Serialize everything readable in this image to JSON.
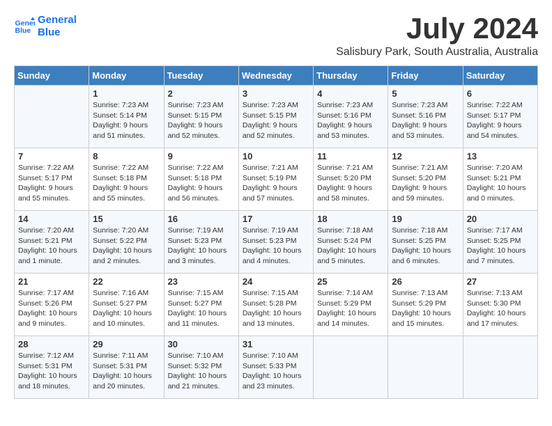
{
  "logo": {
    "line1": "General",
    "line2": "Blue"
  },
  "title": "July 2024",
  "subtitle": "Salisbury Park, South Australia, Australia",
  "days_header": [
    "Sunday",
    "Monday",
    "Tuesday",
    "Wednesday",
    "Thursday",
    "Friday",
    "Saturday"
  ],
  "weeks": [
    [
      {
        "num": "",
        "detail": ""
      },
      {
        "num": "1",
        "detail": "Sunrise: 7:23 AM\nSunset: 5:14 PM\nDaylight: 9 hours\nand 51 minutes."
      },
      {
        "num": "2",
        "detail": "Sunrise: 7:23 AM\nSunset: 5:15 PM\nDaylight: 9 hours\nand 52 minutes."
      },
      {
        "num": "3",
        "detail": "Sunrise: 7:23 AM\nSunset: 5:15 PM\nDaylight: 9 hours\nand 52 minutes."
      },
      {
        "num": "4",
        "detail": "Sunrise: 7:23 AM\nSunset: 5:16 PM\nDaylight: 9 hours\nand 53 minutes."
      },
      {
        "num": "5",
        "detail": "Sunrise: 7:23 AM\nSunset: 5:16 PM\nDaylight: 9 hours\nand 53 minutes."
      },
      {
        "num": "6",
        "detail": "Sunrise: 7:22 AM\nSunset: 5:17 PM\nDaylight: 9 hours\nand 54 minutes."
      }
    ],
    [
      {
        "num": "7",
        "detail": "Sunrise: 7:22 AM\nSunset: 5:17 PM\nDaylight: 9 hours\nand 55 minutes."
      },
      {
        "num": "8",
        "detail": "Sunrise: 7:22 AM\nSunset: 5:18 PM\nDaylight: 9 hours\nand 55 minutes."
      },
      {
        "num": "9",
        "detail": "Sunrise: 7:22 AM\nSunset: 5:18 PM\nDaylight: 9 hours\nand 56 minutes."
      },
      {
        "num": "10",
        "detail": "Sunrise: 7:21 AM\nSunset: 5:19 PM\nDaylight: 9 hours\nand 57 minutes."
      },
      {
        "num": "11",
        "detail": "Sunrise: 7:21 AM\nSunset: 5:20 PM\nDaylight: 9 hours\nand 58 minutes."
      },
      {
        "num": "12",
        "detail": "Sunrise: 7:21 AM\nSunset: 5:20 PM\nDaylight: 9 hours\nand 59 minutes."
      },
      {
        "num": "13",
        "detail": "Sunrise: 7:20 AM\nSunset: 5:21 PM\nDaylight: 10 hours\nand 0 minutes."
      }
    ],
    [
      {
        "num": "14",
        "detail": "Sunrise: 7:20 AM\nSunset: 5:21 PM\nDaylight: 10 hours\nand 1 minute."
      },
      {
        "num": "15",
        "detail": "Sunrise: 7:20 AM\nSunset: 5:22 PM\nDaylight: 10 hours\nand 2 minutes."
      },
      {
        "num": "16",
        "detail": "Sunrise: 7:19 AM\nSunset: 5:23 PM\nDaylight: 10 hours\nand 3 minutes."
      },
      {
        "num": "17",
        "detail": "Sunrise: 7:19 AM\nSunset: 5:23 PM\nDaylight: 10 hours\nand 4 minutes."
      },
      {
        "num": "18",
        "detail": "Sunrise: 7:18 AM\nSunset: 5:24 PM\nDaylight: 10 hours\nand 5 minutes."
      },
      {
        "num": "19",
        "detail": "Sunrise: 7:18 AM\nSunset: 5:25 PM\nDaylight: 10 hours\nand 6 minutes."
      },
      {
        "num": "20",
        "detail": "Sunrise: 7:17 AM\nSunset: 5:25 PM\nDaylight: 10 hours\nand 7 minutes."
      }
    ],
    [
      {
        "num": "21",
        "detail": "Sunrise: 7:17 AM\nSunset: 5:26 PM\nDaylight: 10 hours\nand 9 minutes."
      },
      {
        "num": "22",
        "detail": "Sunrise: 7:16 AM\nSunset: 5:27 PM\nDaylight: 10 hours\nand 10 minutes."
      },
      {
        "num": "23",
        "detail": "Sunrise: 7:15 AM\nSunset: 5:27 PM\nDaylight: 10 hours\nand 11 minutes."
      },
      {
        "num": "24",
        "detail": "Sunrise: 7:15 AM\nSunset: 5:28 PM\nDaylight: 10 hours\nand 13 minutes."
      },
      {
        "num": "25",
        "detail": "Sunrise: 7:14 AM\nSunset: 5:29 PM\nDaylight: 10 hours\nand 14 minutes."
      },
      {
        "num": "26",
        "detail": "Sunrise: 7:13 AM\nSunset: 5:29 PM\nDaylight: 10 hours\nand 15 minutes."
      },
      {
        "num": "27",
        "detail": "Sunrise: 7:13 AM\nSunset: 5:30 PM\nDaylight: 10 hours\nand 17 minutes."
      }
    ],
    [
      {
        "num": "28",
        "detail": "Sunrise: 7:12 AM\nSunset: 5:31 PM\nDaylight: 10 hours\nand 18 minutes."
      },
      {
        "num": "29",
        "detail": "Sunrise: 7:11 AM\nSunset: 5:31 PM\nDaylight: 10 hours\nand 20 minutes."
      },
      {
        "num": "30",
        "detail": "Sunrise: 7:10 AM\nSunset: 5:32 PM\nDaylight: 10 hours\nand 21 minutes."
      },
      {
        "num": "31",
        "detail": "Sunrise: 7:10 AM\nSunset: 5:33 PM\nDaylight: 10 hours\nand 23 minutes."
      },
      {
        "num": "",
        "detail": ""
      },
      {
        "num": "",
        "detail": ""
      },
      {
        "num": "",
        "detail": ""
      }
    ]
  ]
}
